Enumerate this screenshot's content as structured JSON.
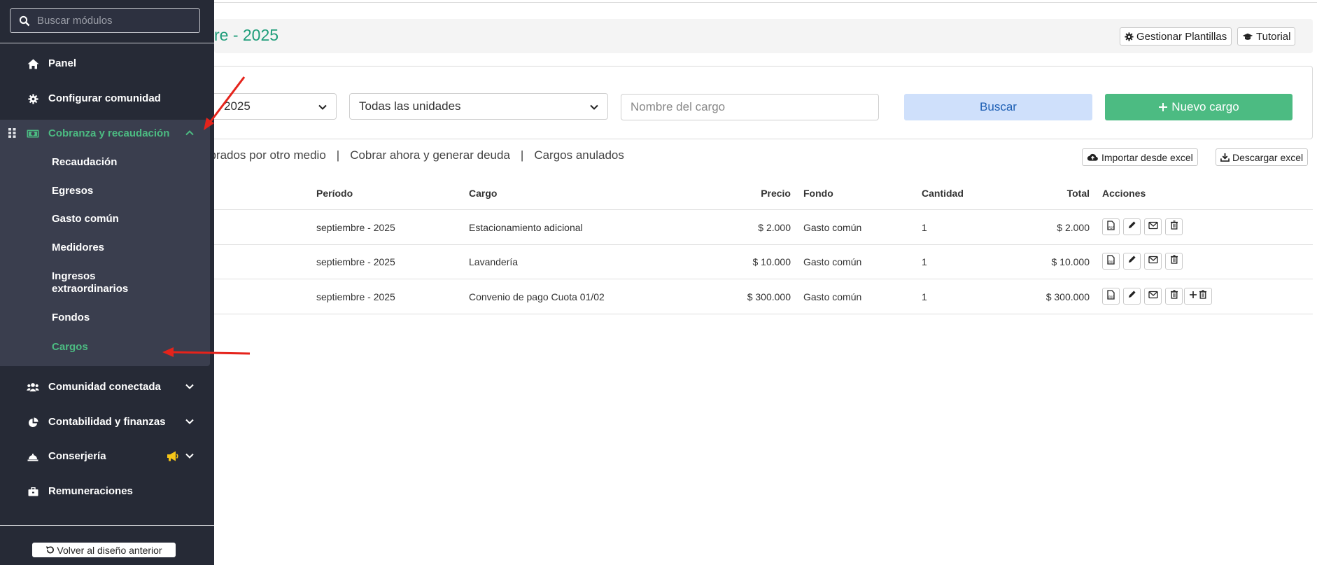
{
  "sidebar": {
    "search_placeholder": "Buscar módulos",
    "items": [
      {
        "label": "Panel",
        "icon": "home-icon"
      },
      {
        "label": "Configurar comunidad",
        "icon": "gear-icon"
      },
      {
        "label": "Cobranza y recaudación",
        "icon": "money-icon",
        "expanded": true
      },
      {
        "label": "Comunidad conectada",
        "icon": "users-icon"
      },
      {
        "label": "Contabilidad y finanzas",
        "icon": "pie-chart-icon"
      },
      {
        "label": "Conserjería",
        "icon": "concierge-bell-icon",
        "badge_icon": "megaphone-icon"
      },
      {
        "label": "Remuneraciones",
        "icon": "briefcase-icon"
      }
    ],
    "sub_items": [
      {
        "label": "Recaudación"
      },
      {
        "label": "Egresos"
      },
      {
        "label": "Gasto común"
      },
      {
        "label": "Medidores"
      },
      {
        "label": "Ingresos extraordinarios"
      },
      {
        "label": "Fondos"
      },
      {
        "label": "Cargos",
        "active": true
      }
    ],
    "back_label": "Volver al diseño anterior"
  },
  "header": {
    "title": "re - 2025",
    "manage_templates": "Gestionar Plantillas",
    "tutorial": "Tutorial"
  },
  "filters": {
    "period_value": "2025",
    "units_value": "Todas las unidades",
    "name_placeholder": "Nombre del cargo",
    "search_label": "Buscar",
    "new_label": "Nuevo cargo"
  },
  "subnav": {
    "tab1": "obrados por otro medio",
    "tab2": "Cobrar ahora y generar deuda",
    "tab3": "Cargos anulados",
    "separator": "|",
    "import_label": "Importar desde excel",
    "download_label": "Descargar excel"
  },
  "table": {
    "headers": {
      "periodo": "Período",
      "cargo": "Cargo",
      "precio": "Precio",
      "fondo": "Fondo",
      "cantidad": "Cantidad",
      "total": "Total",
      "acciones": "Acciones"
    },
    "rows": [
      {
        "periodo": "septiembre - 2025",
        "cargo": "Estacionamiento adicional",
        "precio": "$ 2.000",
        "fondo": "Gasto común",
        "cantidad": "1",
        "total": "$ 2.000"
      },
      {
        "periodo": "septiembre - 2025",
        "cargo": "Lavandería",
        "precio": "$ 10.000",
        "fondo": "Gasto común",
        "cantidad": "1",
        "total": "$ 10.000"
      },
      {
        "periodo": "septiembre - 2025",
        "cargo": "Convenio de pago Cuota 01/02",
        "precio": "$ 300.000",
        "fondo": "Gasto común",
        "cantidad": "1",
        "total": "$ 300.000"
      }
    ]
  },
  "colors": {
    "accent": "#4cbb82",
    "sidebar_bg": "#262a36",
    "sidebar_group_bg": "#3a3e4e",
    "title": "#1f9d7a",
    "search_btn_bg": "#cfe0fb",
    "annotation": "#e5231b"
  }
}
